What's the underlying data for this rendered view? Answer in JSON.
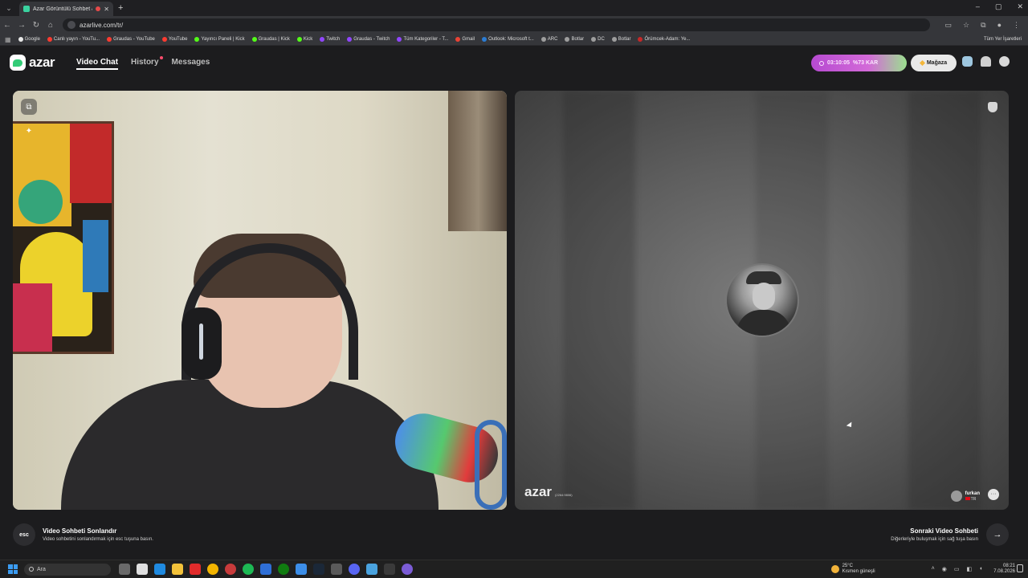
{
  "browser": {
    "tab_title": "Azar Görüntülü Sohbet &",
    "url": "azarlive.com/tr/",
    "bookmarks": [
      {
        "label": "Google",
        "color": "#e8e8e8"
      },
      {
        "label": "Canlı yayın - YouTu...",
        "color": "#ff3b30"
      },
      {
        "label": "Graudas - YouTube",
        "color": "#ff3b30"
      },
      {
        "label": "YouTube",
        "color": "#ff3b30"
      },
      {
        "label": "Yayıncı Paneli | Kick",
        "color": "#53fc18"
      },
      {
        "label": "Graudas | Kick",
        "color": "#53fc18"
      },
      {
        "label": "Kick",
        "color": "#53fc18"
      },
      {
        "label": "Twitch",
        "color": "#9146ff"
      },
      {
        "label": "Graudas - Twitch",
        "color": "#9146ff"
      },
      {
        "label": "Tüm Kategoriler - T...",
        "color": "#9146ff"
      },
      {
        "label": "Gmail",
        "color": "#ea4335"
      },
      {
        "label": "Outlook: Microsoft t...",
        "color": "#2b7cd3"
      },
      {
        "label": "ARC",
        "color": "#9e9e9e"
      },
      {
        "label": "Botlar",
        "color": "#9e9e9e"
      },
      {
        "label": "DC",
        "color": "#9e9e9e"
      },
      {
        "label": "Botlar",
        "color": "#9e9e9e"
      },
      {
        "label": "Örümcek-Adam: Ye...",
        "color": "#c62828"
      }
    ],
    "bookmarks_right": "Tüm Yer İşaretleri"
  },
  "header": {
    "logo": "azar",
    "nav": {
      "video_chat": "Video Chat",
      "history": "History",
      "messages": "Messages"
    },
    "promo": {
      "timer": "03:10:05",
      "discount": "%73 KAR"
    },
    "shop": "Mağaza"
  },
  "remote": {
    "watermark": "azar",
    "watermark_id": "(2264:9806)",
    "partner_name": "furkan",
    "partner_country": "TR"
  },
  "footer": {
    "esc_key": "esc",
    "end_title": "Video Sohbeti Sonlandır",
    "end_sub": "Video sohbetini sonlandırmak için esc tuşuna basın.",
    "next_title": "Sonraki Video Sohbeti",
    "next_sub": "Diğerleriyle buluşmak için sağ tuşa basın"
  },
  "taskbar": {
    "search": "Ara",
    "temp": "25°C",
    "weather": "Kısmen güneşli",
    "time": "08:21",
    "date": "7.08.2026"
  },
  "colors": {
    "accent": "#33cc77",
    "promo": "#c35ad6",
    "bg": "#1c1c1e"
  }
}
